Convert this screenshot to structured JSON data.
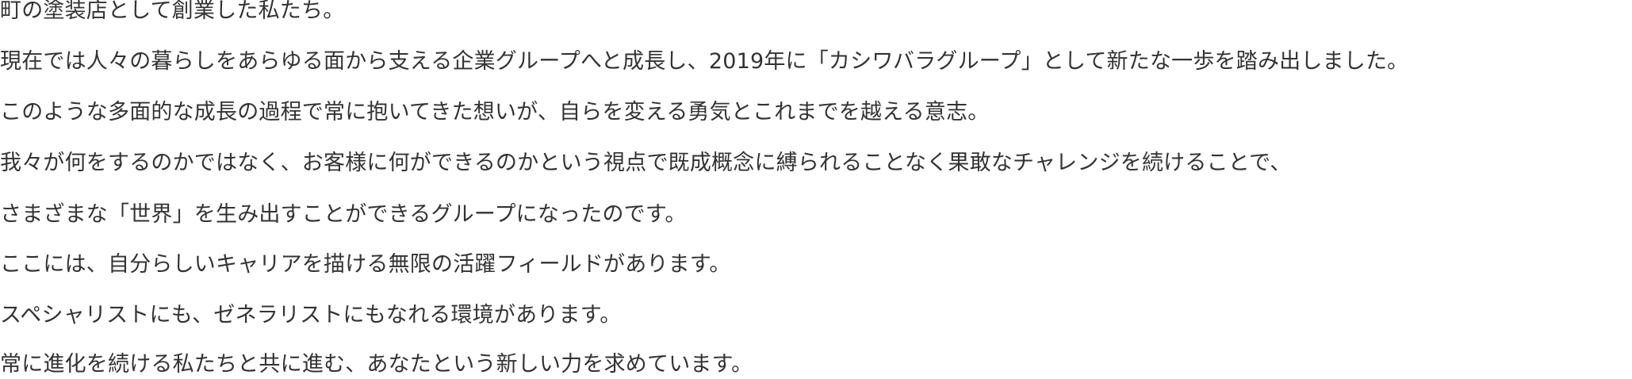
{
  "message": {
    "lines": [
      "町の塗装店として創業した私たち。",
      "現在では人々の暮らしをあらゆる面から支える企業グループへと成長し、2019年に「カシワバラグループ」として新たな一歩を踏み出しました。",
      "このような多面的な成長の過程で常に抱いてきた想いが、自らを変える勇気とこれまでを越える意志。",
      "我々が何をするのかではなく、お客様に何ができるのかという視点で既成概念に縛られることなく果敢なチャレンジを続けることで、",
      "さまざまな「世界」を生み出すことができるグループになったのです。",
      "ここには、自分らしいキャリアを描ける無限の活躍フィールドがあります。",
      "スペシャリストにも、ゼネラリストにもなれる環境があります。",
      "常に進化を続ける私たちと共に進む、あなたという新しい力を求めています。"
    ]
  }
}
